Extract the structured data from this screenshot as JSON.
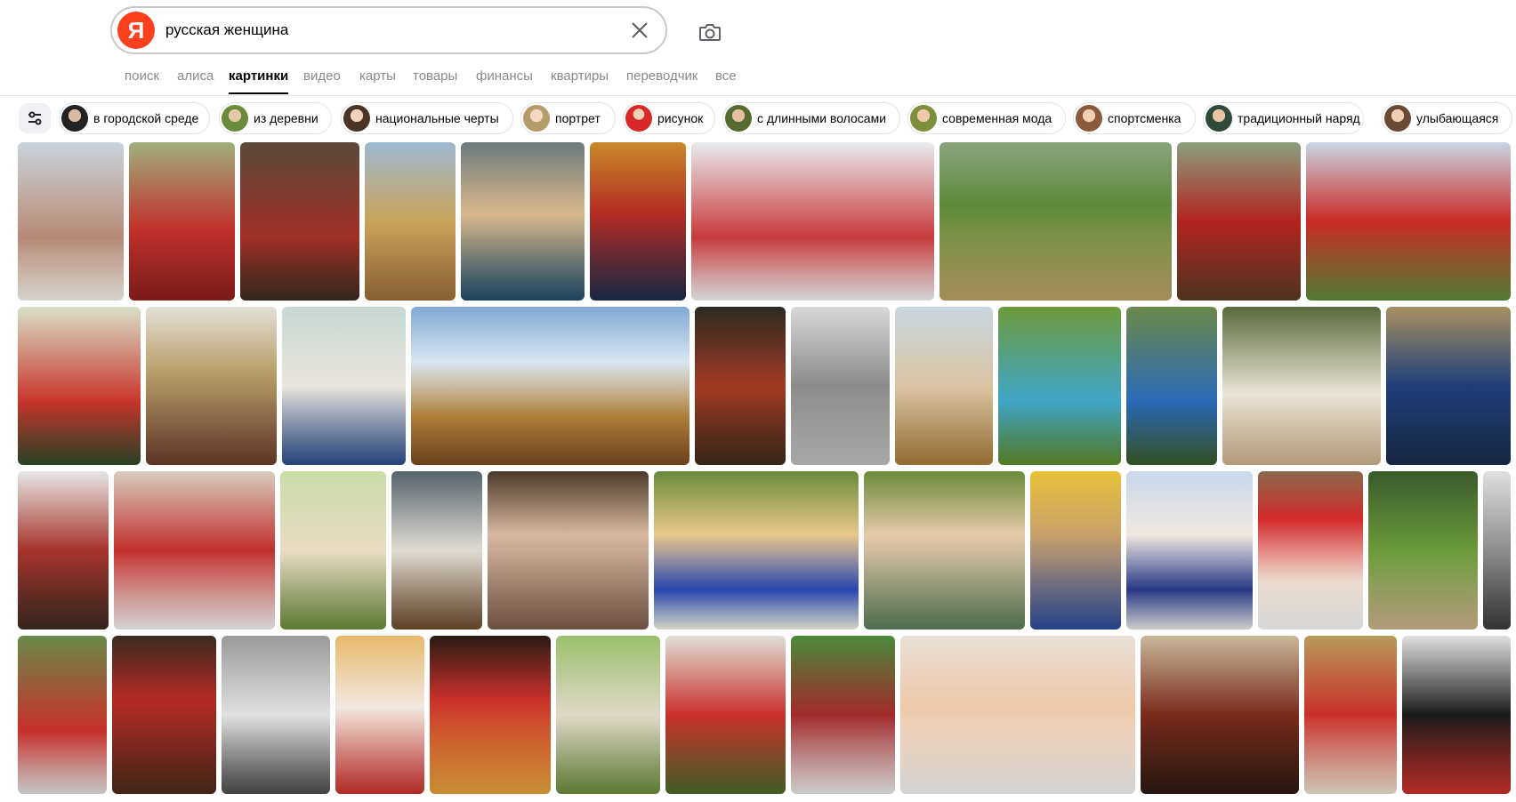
{
  "search": {
    "logo_letter": "Я",
    "query": "русская женщина"
  },
  "tabs": [
    {
      "label": "поиск"
    },
    {
      "label": "алиса"
    },
    {
      "label": "картинки",
      "active": true
    },
    {
      "label": "видео"
    },
    {
      "label": "карты"
    },
    {
      "label": "товары"
    },
    {
      "label": "финансы"
    },
    {
      "label": "квартиры"
    },
    {
      "label": "переводчик"
    },
    {
      "label": "все"
    }
  ],
  "filters": [
    {
      "label": "в городской среде"
    },
    {
      "label": "из деревни"
    },
    {
      "label": "национальные черты"
    },
    {
      "label": "портрет"
    },
    {
      "label": "рисунок"
    },
    {
      "label": "с длинными волосами"
    },
    {
      "label": "современная мода"
    },
    {
      "label": "спортсменка"
    },
    {
      "label": "традиционный наряд"
    },
    {
      "label": "улыбающаяся"
    }
  ],
  "icons": {
    "clear": "close-icon",
    "camera": "camera-icon",
    "filters": "sliders-icon"
  },
  "colors": {
    "brand": "#fc3f1d",
    "text_muted": "#8a8a8a"
  }
}
